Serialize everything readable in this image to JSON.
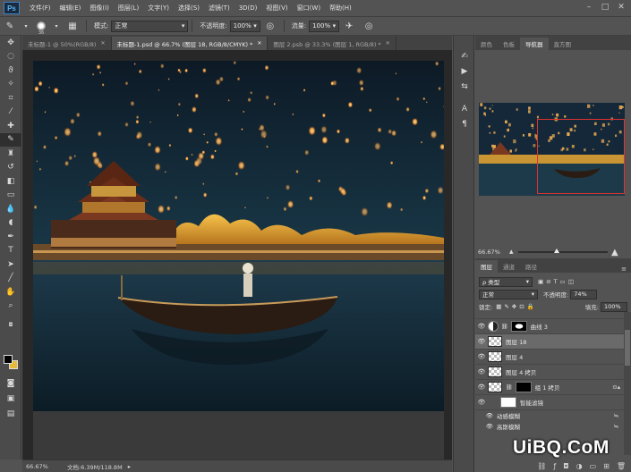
{
  "app": {
    "logo": "Ps"
  },
  "menu": [
    "文件(F)",
    "编辑(E)",
    "图像(I)",
    "图层(L)",
    "文字(Y)",
    "选择(S)",
    "滤镜(T)",
    "3D(D)",
    "视图(V)",
    "窗口(W)",
    "帮助(H)"
  ],
  "window_controls": {
    "minimize": "–",
    "maximize": "□",
    "close": "✕"
  },
  "options": {
    "brush_size": "36",
    "mode_label": "模式:",
    "mode_value": "正常",
    "opacity_label": "不透明度:",
    "opacity_value": "100%",
    "flow_label": "流量:",
    "flow_value": "100%"
  },
  "tabs": [
    {
      "label": "未标题-1 @ 50%(RGB/8)",
      "close": "✕"
    },
    {
      "label": "未标题-1.psd @ 66.7% (图层 18, RGB/8/CMYK) *",
      "close": "✕"
    },
    {
      "label": "图层 2.psb @ 33.3% (图层 1, RGB/8) *",
      "close": "✕"
    }
  ],
  "panel_top_tabs": [
    "颜色",
    "色板",
    "导航器",
    "直方图"
  ],
  "navigator": {
    "zoom": "66.67%"
  },
  "layers_panel": {
    "tabs": [
      "图层",
      "通道",
      "路径"
    ],
    "filter_kind": "ρ 类型",
    "blend_mode": "正常",
    "opacity_label": "不透明度:",
    "opacity_value": "74%",
    "lock_label": "锁定:",
    "fill_label": "填充:",
    "fill_value": "100%",
    "items": [
      {
        "name": "曲线 3"
      },
      {
        "name": "图层 18"
      },
      {
        "name": "图层 4"
      },
      {
        "name": "图层 4 拷贝"
      },
      {
        "name": "组 1 拷贝"
      },
      {
        "name": "智能滤镜"
      },
      {
        "name": "动感模糊"
      },
      {
        "name": "高斯模糊"
      }
    ]
  },
  "status": {
    "zoom": "66.67%",
    "doc": "文档:6.39M/118.8M"
  },
  "watermark": "UiBQ.CoM",
  "colors": {
    "foreground": "#000000",
    "background": "#e5b93a",
    "nav_frame": "#e0322f"
  }
}
